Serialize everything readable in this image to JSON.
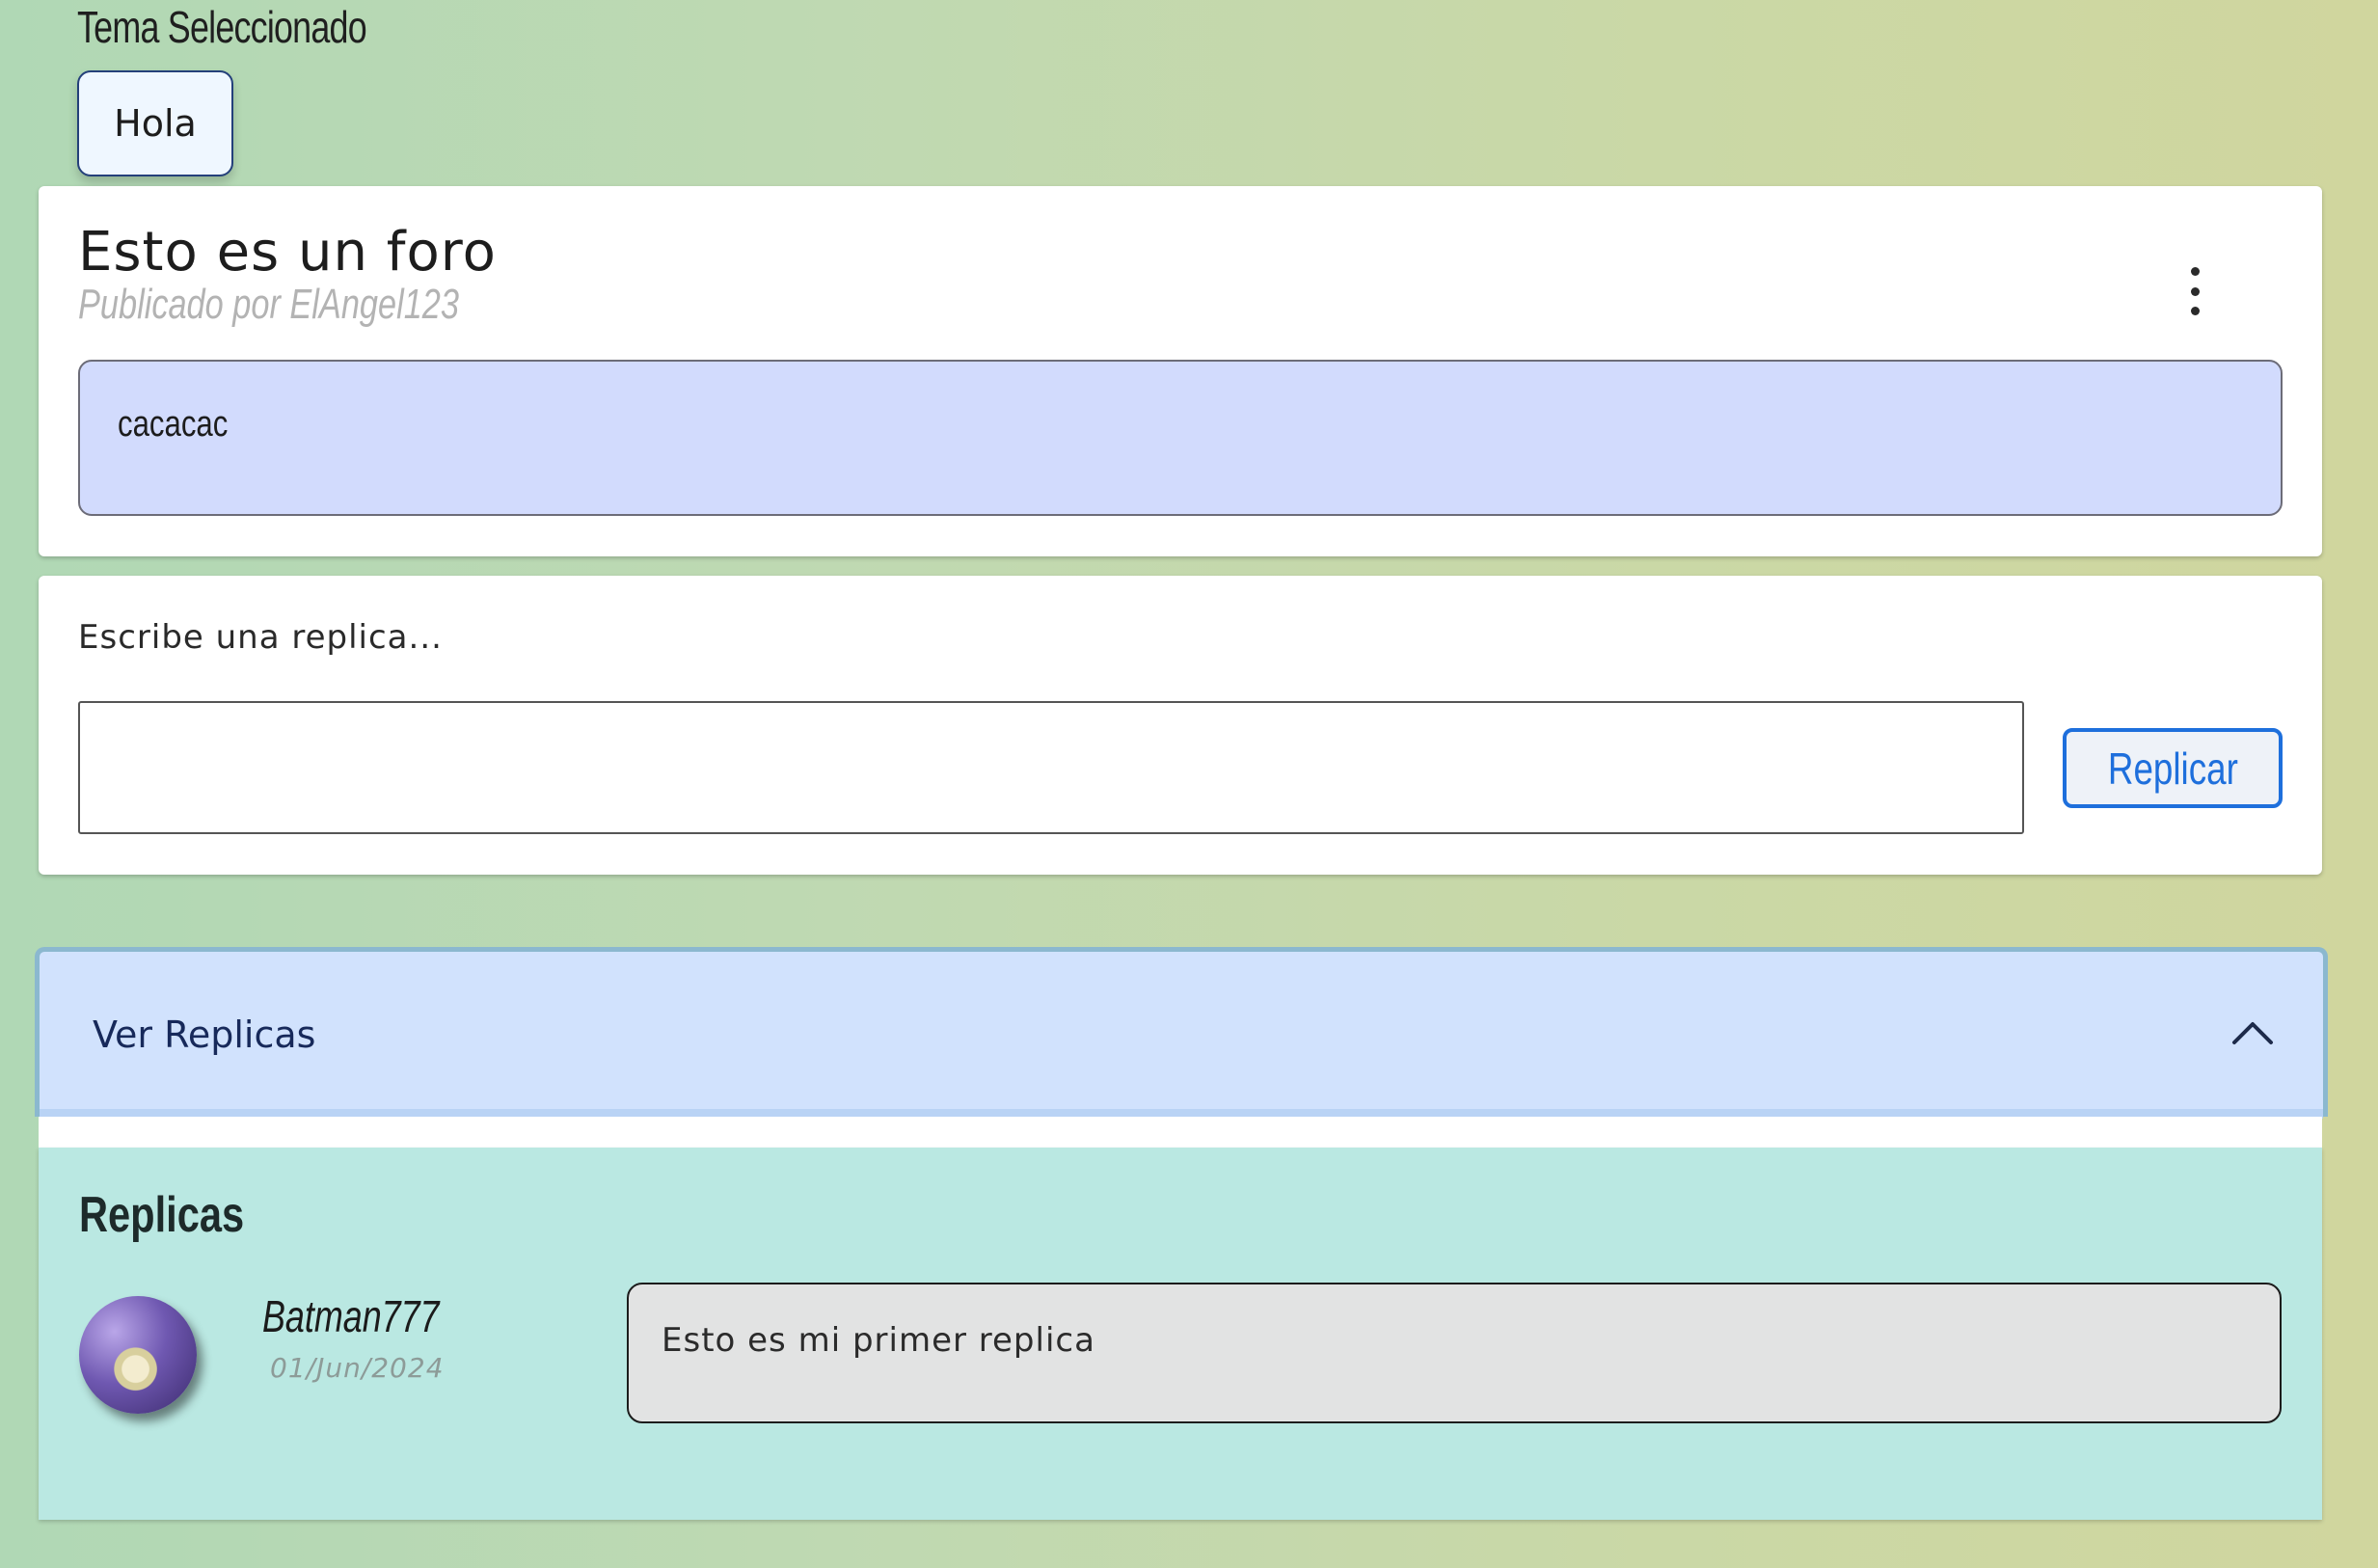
{
  "topic": {
    "label": "Tema Seleccionado",
    "chip": "Hola"
  },
  "post": {
    "title": "Esto es un foro",
    "author": "Publicado por ElAngel123",
    "body": "cacacac",
    "menu_icon": "kebab-menu-icon"
  },
  "reply_form": {
    "prompt": "Escribe una replica...",
    "input_value": "",
    "button_label": "Replicar"
  },
  "replies_section": {
    "toggle_label": "Ver Replicas",
    "toggle_icon": "chevron-up-icon",
    "heading": "Replicas",
    "items": [
      {
        "user": "Batman777",
        "date": "01/Jun/2024",
        "text": "Esto es mi primer replica"
      }
    ]
  },
  "colors": {
    "accent_blue": "#1e6fdc",
    "post_body_bg": "#d2dbfd",
    "accordion_bg": "#d1e2fd",
    "replies_bg": "#bae8e2"
  }
}
